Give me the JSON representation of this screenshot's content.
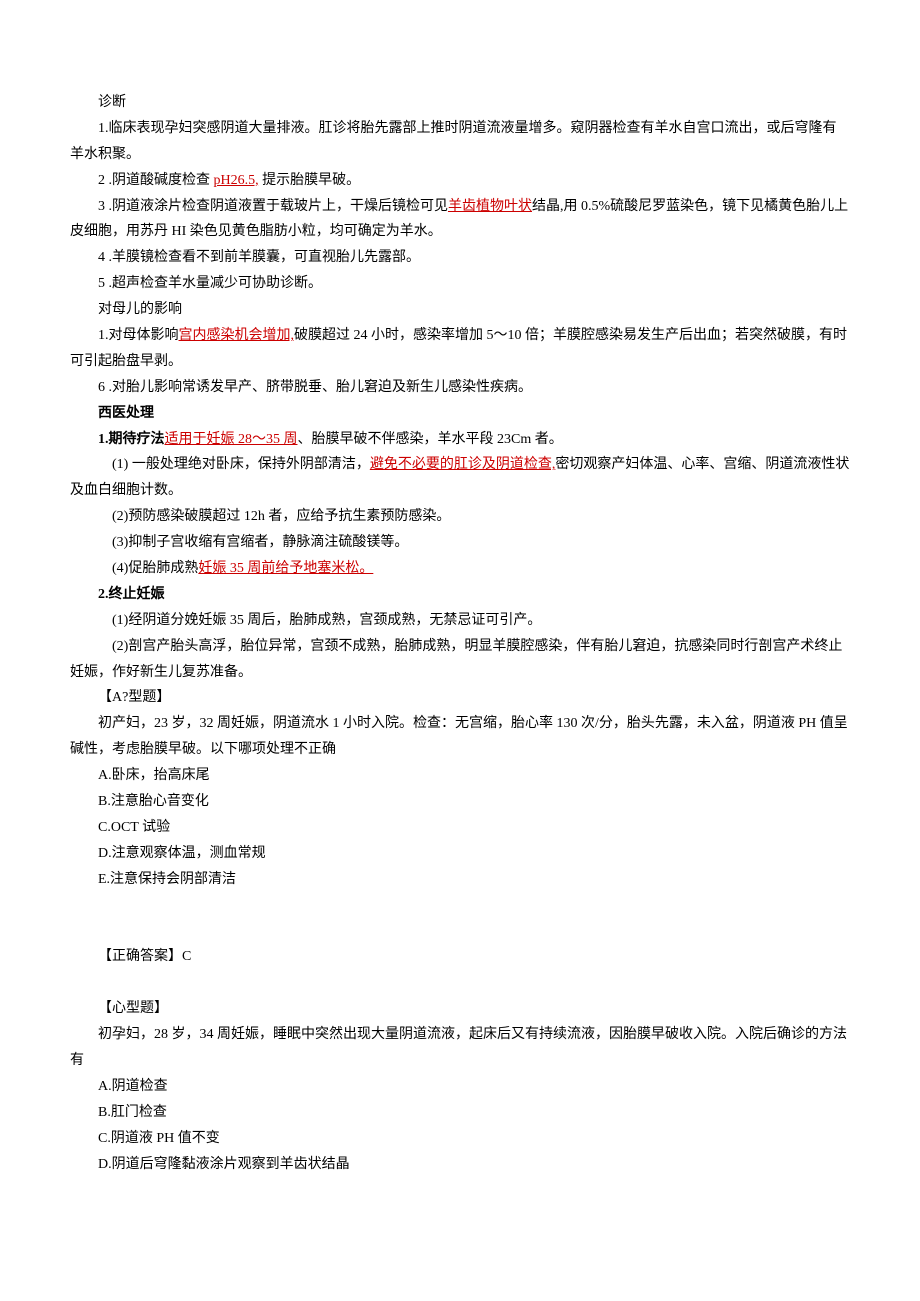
{
  "diagnosis": {
    "title": "诊断",
    "item1_a": "1.临床表现孕妇突感阴道大量排液。肛诊将胎先露部上推时阴道流液量增多。窥阴器检查有羊水自宫口流出，或后穹隆有羊水积聚。",
    "item2_a": "2 .阴道酸碱度检查 ",
    "item2_red": "pH26.5,",
    "item2_c": " 提示胎膜早破。",
    "item3_a": "3 .阴道液涂片检查阴道液置于载玻片上，干燥后镜检可见",
    "item3_red": "羊齿植物叶状",
    "item3_c": "结晶,用 0.5%硫酸尼罗蓝染色，镜下见橘黄色胎儿上皮细胞，用苏丹 HI 染色见黄色脂肪小粒，均可确定为羊水。",
    "item4": "4 .羊膜镜检查看不到前羊膜囊，可直视胎儿先露部。",
    "item5": "5 .超声检查羊水量减少可协助诊断。"
  },
  "effect": {
    "title": "对母儿的影响",
    "item1_a": "1.对母体影响",
    "item1_red": "宫内感染机会增加,",
    "item1_c": "破膜超过 24 小时，感染率增加 5～10 倍；羊膜腔感染易发生产后出血；若突然破膜，有时可引起胎盘早剥。",
    "item2": "6 .对胎儿影响常诱发早产、脐带脱垂、胎儿窘迫及新生儿感染性疾病。"
  },
  "western": {
    "title": "西医处理",
    "item1_label": "1.期待疗法",
    "item1_red": "适用于妊娠 28～35 周",
    "item1_c": "、胎膜早破不伴感染，羊水平段 23Cm 者。",
    "sub1_a": "(1)   一般处理绝对卧床，保持外阴部清洁，",
    "sub1_red": "避免不必要的肛诊及阴道检查,",
    "sub1_c": "密切观察产妇体温、心率、宫缩、阴道流液性状及血白细胞计数。",
    "sub2": "(2)预防感染破膜超过 12h 者，应给予抗生素预防感染。",
    "sub3": "(3)抑制子宫收缩有宫缩者，静脉滴注硫酸镁等。",
    "sub4_a": "(4)促胎肺成熟",
    "sub4_red": "妊娠 35 周前给予地塞米松。",
    "item2_label": "2.终止妊娠",
    "term1": "(1)经阴道分娩妊娠 35 周后，胎肺成熟，宫颈成熟，无禁忌证可引产。",
    "term2": "(2)剖宫产胎头高浮，胎位异常，宫颈不成熟，胎肺成熟，明显羊膜腔感染，伴有胎儿窘迫，抗感染同时行剖宫产术终止妊娠，作好新生儿复苏准备。"
  },
  "q1": {
    "header": "【A?型题】",
    "stem": "初产妇，23 岁，32 周妊娠，阴道流水 1 小时入院。检查：无宫缩，胎心率 130 次/分，胎头先露，未入盆，阴道液 PH 值呈碱性，考虑胎膜早破。以下哪项处理不正确",
    "optA": "A.卧床，抬高床尾",
    "optB": "B.注意胎心音变化",
    "optC": "C.OCT 试验",
    "optD": "D.注意观察体温，测血常规",
    "optE": "E.注意保持会阴部清洁",
    "answer": "【正确答案】C"
  },
  "q2": {
    "header": "【心型题】",
    "stem": "初孕妇，28 岁，34 周妊娠，睡眠中突然出现大量阴道流液，起床后又有持续流液，因胎膜早破收入院。入院后确诊的方法有",
    "optA": "A.阴道检查",
    "optB": "B.肛门检查",
    "optC": "C.阴道液 PH 值不变",
    "optD": "D.阴道后穹隆黏液涂片观察到羊齿状结晶"
  }
}
